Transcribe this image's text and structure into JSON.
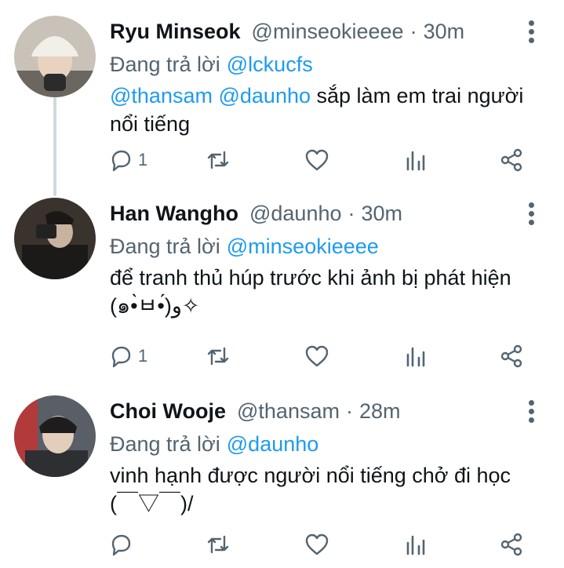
{
  "tweets": [
    {
      "name": "Ryu Minseok",
      "handle": "@minseokieeee",
      "time": "30m",
      "reply_label": "Đang trả lời",
      "reply_to": "@lckucfs",
      "mentions": [
        "@thansam",
        "@daunho"
      ],
      "text_line1": "sắp làm em trai người",
      "text_line2": "nổi tiếng",
      "reply_count": "1",
      "avatar_bg": "#c9c2b8"
    },
    {
      "name": "Han Wangho",
      "handle": "@daunho",
      "time": "30m",
      "reply_label": "Đang trả lời",
      "reply_to": "@minseokieeee",
      "text_line1": "để tranh thủ húp trước khi ảnh bị phát hiện",
      "text_line2": "(๑•̀ㅂ•́)و✧",
      "reply_count": "1",
      "avatar_bg": "#3a332d"
    },
    {
      "name": "Choi Wooje",
      "handle": "@thansam",
      "time": "28m",
      "reply_label": "Đang trả lời",
      "reply_to": "@daunho",
      "text_line1": "vinh hạnh được người nổi tiếng chở đi học",
      "text_line2": "(￣▽￣)/",
      "reply_count": "",
      "avatar_bg": "#5a5e66"
    }
  ],
  "colors": {
    "accent": "#1d9bf0",
    "muted": "#536471",
    "text": "#0f1419",
    "thread_line": "#cfd9de"
  },
  "icons": [
    "reply-icon",
    "retweet-icon",
    "like-icon",
    "analytics-icon",
    "share-icon",
    "more-icon"
  ]
}
